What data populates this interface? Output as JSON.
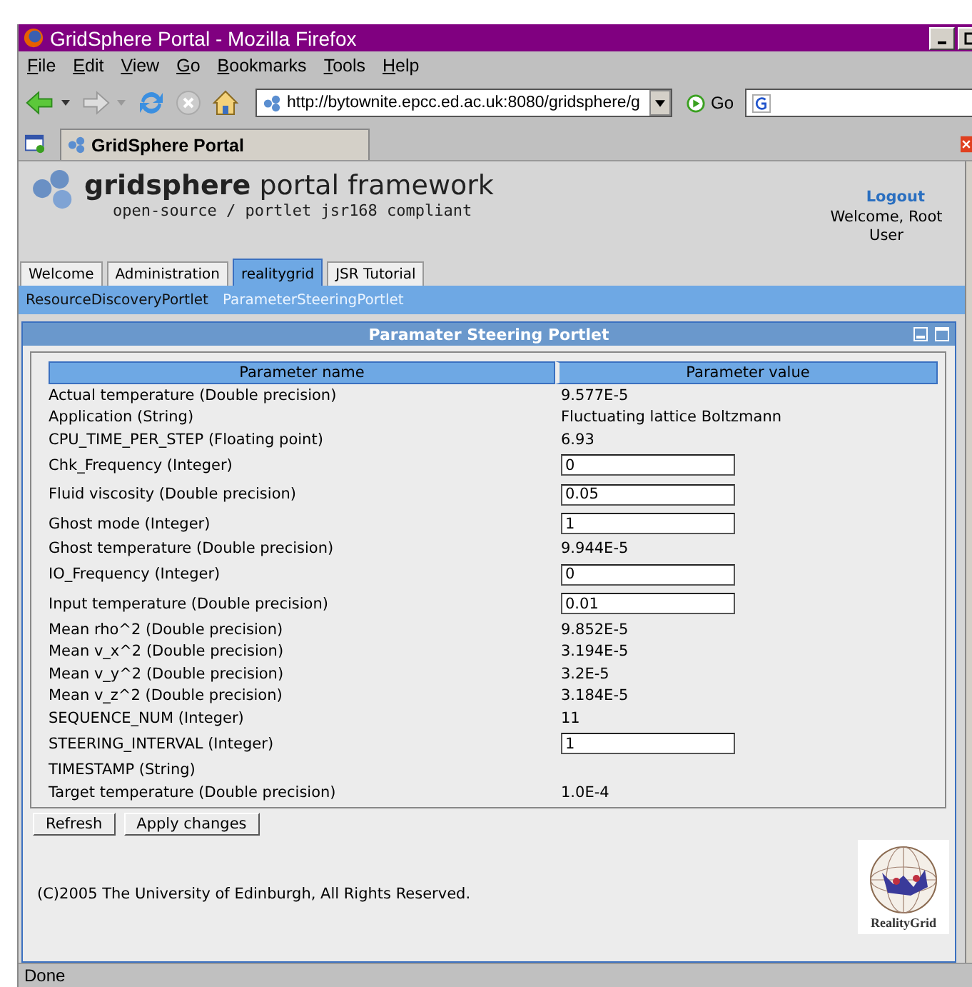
{
  "window": {
    "title": "GridSphere Portal - Mozilla Firefox"
  },
  "menu": [
    "File",
    "Edit",
    "View",
    "Go",
    "Bookmarks",
    "Tools",
    "Help"
  ],
  "toolbar": {
    "url": "http://bytownite.epcc.ed.ac.uk:8080/gridsphere/g",
    "go": "Go"
  },
  "browser_tabs": [
    {
      "label": "GridSphere Portal",
      "selected": true
    }
  ],
  "header": {
    "logo_bold": "gridsphere",
    "logo_rest": "portal framework",
    "tagline": "open-source / portlet jsr168 compliant",
    "logout": "Logout",
    "welcome": "Welcome, Root User"
  },
  "tabs": [
    {
      "label": "Welcome",
      "selected": false
    },
    {
      "label": "Administration",
      "selected": false
    },
    {
      "label": "realitygrid",
      "selected": true
    },
    {
      "label": "JSR Tutorial",
      "selected": false
    }
  ],
  "subtabs": [
    {
      "label": "ResourceDiscoveryPortlet",
      "selected": false
    },
    {
      "label": "ParameterSteeringPortlet",
      "selected": true
    }
  ],
  "portlet": {
    "title": "Paramater Steering Portlet",
    "columns": [
      "Parameter name",
      "Parameter value"
    ],
    "rows": [
      {
        "name": "Actual temperature (Double precision)",
        "kind": "text",
        "value": "9.577E-5"
      },
      {
        "name": "Application (String)",
        "kind": "text",
        "value": "Fluctuating lattice Boltzmann"
      },
      {
        "name": "CPU_TIME_PER_STEP (Floating point)",
        "kind": "text",
        "value": "6.93"
      },
      {
        "name": "Chk_Frequency (Integer)",
        "kind": "input",
        "value": "0"
      },
      {
        "name": "Fluid viscosity (Double precision)",
        "kind": "input",
        "value": "0.05"
      },
      {
        "name": "Ghost mode (Integer)",
        "kind": "input",
        "value": "1"
      },
      {
        "name": "Ghost temperature (Double precision)",
        "kind": "text",
        "value": "9.944E-5"
      },
      {
        "name": "IO_Frequency (Integer)",
        "kind": "input",
        "value": "0"
      },
      {
        "name": "Input temperature (Double precision)",
        "kind": "input",
        "value": "0.01"
      },
      {
        "name": "Mean rho^2 (Double precision)",
        "kind": "text",
        "value": "9.852E-5"
      },
      {
        "name": "Mean v_x^2 (Double precision)",
        "kind": "text",
        "value": "3.194E-5"
      },
      {
        "name": "Mean v_y^2 (Double precision)",
        "kind": "text",
        "value": "3.2E-5"
      },
      {
        "name": "Mean v_z^2 (Double precision)",
        "kind": "text",
        "value": "3.184E-5"
      },
      {
        "name": "SEQUENCE_NUM (Integer)",
        "kind": "text",
        "value": "11"
      },
      {
        "name": "STEERING_INTERVAL (Integer)",
        "kind": "input",
        "value": "1"
      },
      {
        "name": "TIMESTAMP (String)",
        "kind": "text"
      },
      {
        "name": "Target temperature (Double precision)",
        "kind": "text",
        "value": "1.0E-4"
      }
    ],
    "buttons": [
      "Refresh",
      "Apply changes"
    ],
    "footer": "(C)2005 The University of Edinburgh, All Rights Reserved.",
    "logo_caption": "RealityGrid"
  },
  "status_bar": "Done"
}
